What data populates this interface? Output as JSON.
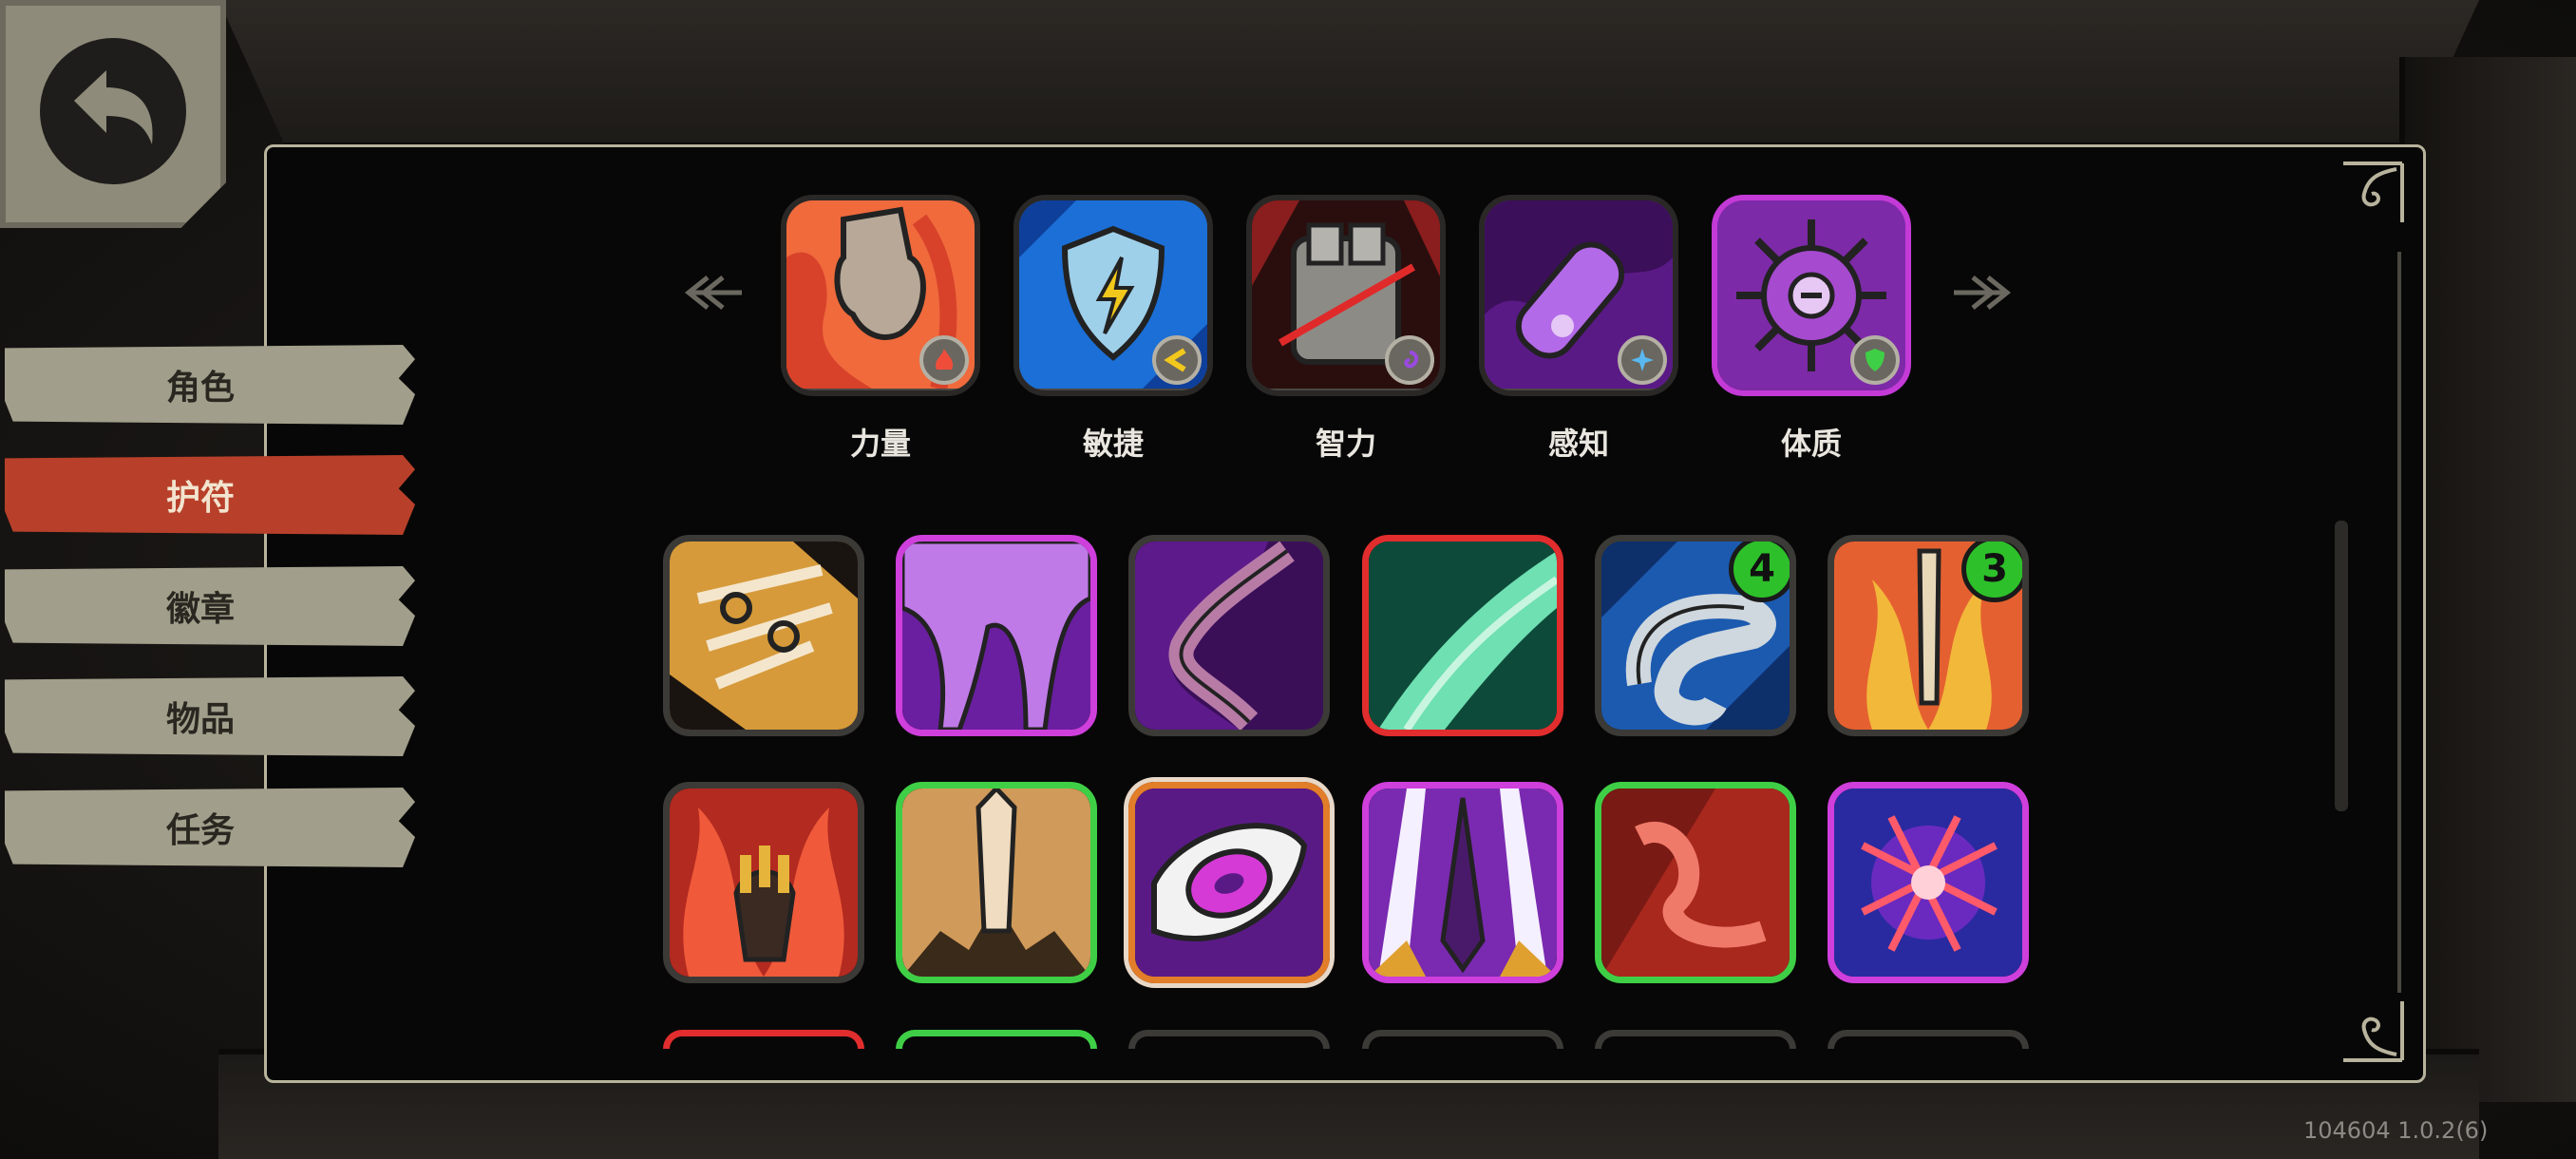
{
  "nav": {
    "back_icon": "back-arrow-icon",
    "tabs": [
      {
        "label": "角色",
        "active": false
      },
      {
        "label": "护符",
        "active": true
      },
      {
        "label": "徽章",
        "active": false
      },
      {
        "label": "物品",
        "active": false
      },
      {
        "label": "任务",
        "active": false
      }
    ]
  },
  "attributes": [
    {
      "label": "力量",
      "icon": "strength-fist-icon",
      "badge_icon": "fire-badge-icon",
      "selected": false
    },
    {
      "label": "敏捷",
      "icon": "agility-shield-icon",
      "badge_icon": "lightning-badge-icon",
      "selected": false
    },
    {
      "label": "智力",
      "icon": "intelligence-armor-icon",
      "badge_icon": "swirl-badge-icon",
      "selected": false
    },
    {
      "label": "感知",
      "icon": "perception-vial-icon",
      "badge_icon": "star-badge-icon",
      "selected": false
    },
    {
      "label": "体质",
      "icon": "constitution-sigil-icon",
      "badge_icon": "shield-badge-icon",
      "selected": true
    }
  ],
  "amulets": [
    {
      "icon": "chain-link-icon",
      "rarity": "common",
      "count": ""
    },
    {
      "icon": "purple-slime-icon",
      "rarity": "epic",
      "count": ""
    },
    {
      "icon": "purple-claw-icon",
      "rarity": "common",
      "count": ""
    },
    {
      "icon": "green-blade-icon",
      "rarity": "legendary",
      "count": ""
    },
    {
      "icon": "lightning-eel-icon",
      "rarity": "common",
      "count": "4"
    },
    {
      "icon": "flaming-sword-icon",
      "rarity": "common",
      "count": "3"
    },
    {
      "icon": "burning-hand-icon",
      "rarity": "common",
      "count": ""
    },
    {
      "icon": "earth-spike-icon",
      "rarity": "rare",
      "count": ""
    },
    {
      "icon": "void-eye-icon",
      "rarity": "selected",
      "count": ""
    },
    {
      "icon": "dark-spire-icon",
      "rarity": "epic",
      "count": ""
    },
    {
      "icon": "crimson-vine-icon",
      "rarity": "rare",
      "count": ""
    },
    {
      "icon": "crossed-slash-icon",
      "rarity": "epic",
      "count": ""
    }
  ],
  "version": "104604 1.0.2(6)",
  "colors": {
    "active_tab": "#b8402a",
    "tab": "#a19e8b",
    "rare": "#3fcf46",
    "epic": "#cf3fdc",
    "legendary": "#e12d2d",
    "count_badge": "#2dc02a"
  }
}
